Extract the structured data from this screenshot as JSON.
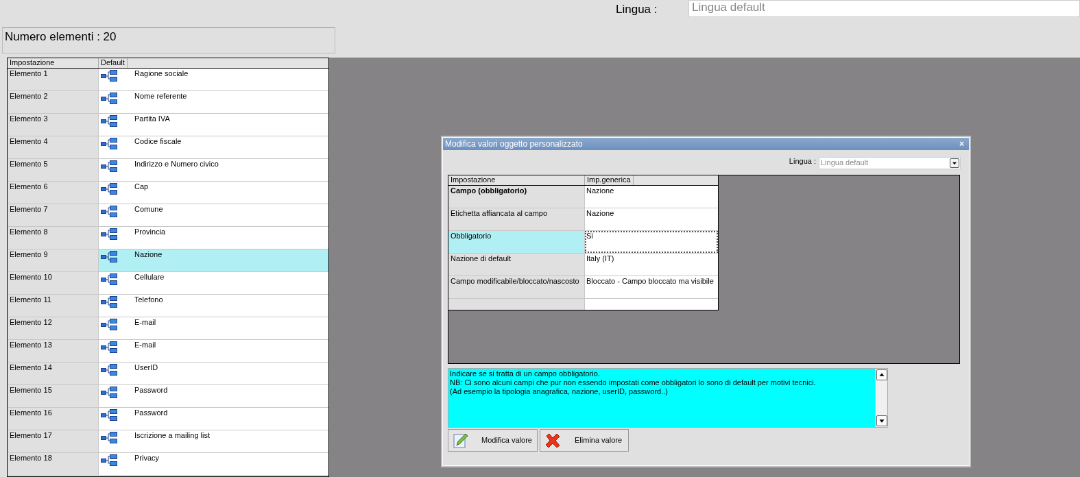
{
  "top": {
    "language_label": "Lingua :",
    "language_value": "Lingua default",
    "disabled": true
  },
  "count_label": "Numero elementi : 20",
  "list": {
    "columns": [
      "Impostazione",
      "Default"
    ],
    "rows": [
      {
        "name": "Elemento 1",
        "value": "Ragione sociale",
        "selected": false
      },
      {
        "name": "Elemento 2",
        "value": "Nome referente",
        "selected": false
      },
      {
        "name": "Elemento 3",
        "value": "Partita IVA",
        "selected": false
      },
      {
        "name": "Elemento 4",
        "value": "Codice fiscale",
        "selected": false
      },
      {
        "name": "Elemento 5",
        "value": "Indirizzo e Numero civico",
        "selected": false
      },
      {
        "name": "Elemento 6",
        "value": "Cap",
        "selected": false
      },
      {
        "name": "Elemento 7",
        "value": "Comune",
        "selected": false
      },
      {
        "name": "Elemento 8",
        "value": "Provincia",
        "selected": false
      },
      {
        "name": "Elemento 9",
        "value": "Nazione",
        "selected": true
      },
      {
        "name": "Elemento 10",
        "value": "Cellulare",
        "selected": false
      },
      {
        "name": "Elemento 11",
        "value": "Telefono",
        "selected": false
      },
      {
        "name": "Elemento 12",
        "value": "E-mail",
        "selected": false
      },
      {
        "name": "Elemento 13",
        "value": "E-mail",
        "selected": false
      },
      {
        "name": "Elemento 14",
        "value": "UserID",
        "selected": false
      },
      {
        "name": "Elemento 15",
        "value": "Password",
        "selected": false
      },
      {
        "name": "Elemento 16",
        "value": "Password",
        "selected": false
      },
      {
        "name": "Elemento 17",
        "value": "Iscrizione a mailing list",
        "selected": false
      },
      {
        "name": "Elemento 18",
        "value": "Privacy",
        "selected": false
      }
    ]
  },
  "dialog": {
    "title": "Modifica valori oggetto personalizzato",
    "close": "×",
    "language_label": "Lingua :",
    "language_value": "Lingua default",
    "disabled": true,
    "grid": {
      "columns": [
        "Impostazione",
        "Imp.generica"
      ],
      "rows": [
        {
          "setting": "Campo (obbligatorio)",
          "value": "Nazione",
          "bold": true,
          "selected": false
        },
        {
          "setting": "Etichetta affiancata al campo",
          "value": "Nazione",
          "bold": false,
          "selected": false
        },
        {
          "setting": "Obbligatorio",
          "value": "Si",
          "bold": false,
          "selected": true
        },
        {
          "setting": "Nazione di default",
          "value": "Italy (IT)",
          "bold": false,
          "selected": false
        },
        {
          "setting": "Campo modificabile/bloccato/nascosto",
          "value": "Bloccato - Campo bloccato ma visibile",
          "bold": false,
          "selected": false
        }
      ]
    },
    "description": [
      "Indicare se si tratta di un campo obbligatorio.",
      "NB: Ci sono alcuni campi che pur non essendo impostati come obbligatori lo sono di default per motivi tecnici.",
      "(Ad esempio la tipologia anagrafica, nazione, userID, password..)"
    ],
    "buttons": [
      {
        "label": "Modifica valore",
        "kind": "edit"
      },
      {
        "label": "Elimina valore",
        "kind": "delete"
      }
    ]
  }
}
